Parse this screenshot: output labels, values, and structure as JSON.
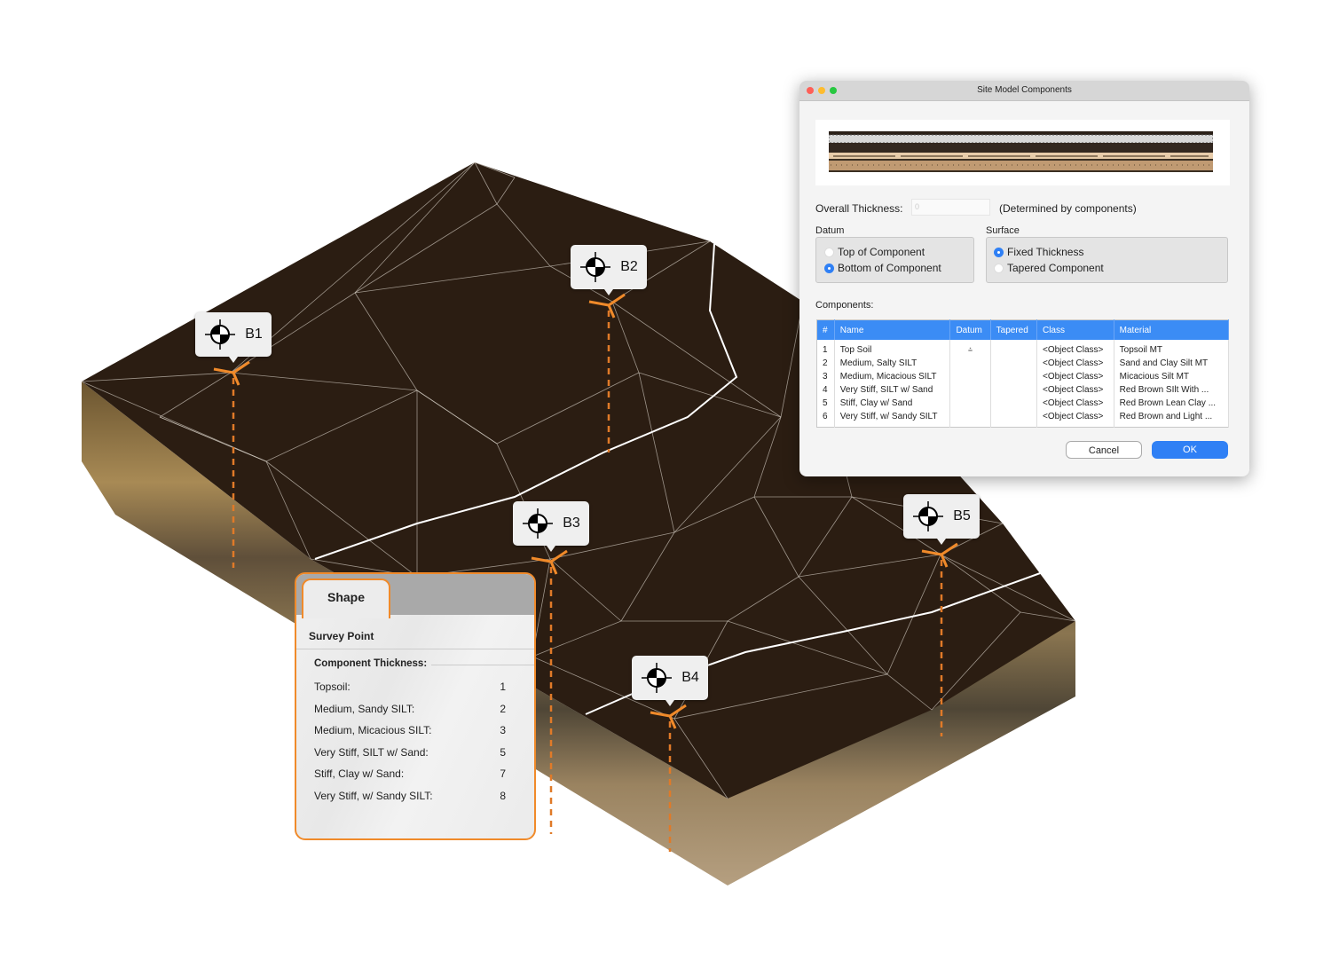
{
  "markers": [
    {
      "label": "B1"
    },
    {
      "label": "B2"
    },
    {
      "label": "B3"
    },
    {
      "label": "B4"
    },
    {
      "label": "B5"
    }
  ],
  "marker_icon": "survey-point-crosshair-icon",
  "colors": {
    "accent_orange": "#f08a2a",
    "terrain_top": "#2b1d12",
    "dialog_blue": "#3b8cf5"
  },
  "dialog": {
    "title": "Site Model Components",
    "overall_thickness_label": "Overall Thickness:",
    "overall_thickness_value": "0",
    "overall_thickness_note": "(Determined by components)",
    "datum": {
      "label": "Datum",
      "options": [
        {
          "label": "Top of Component",
          "selected": false
        },
        {
          "label": "Bottom of Component",
          "selected": true
        }
      ]
    },
    "surface": {
      "label": "Surface",
      "options": [
        {
          "label": "Fixed Thickness",
          "selected": true
        },
        {
          "label": "Tapered Component",
          "selected": false
        }
      ]
    },
    "components_label": "Components:",
    "columns": [
      "#",
      "Name",
      "Datum",
      "Tapered",
      "Class",
      "Material"
    ],
    "rows": [
      {
        "n": "1",
        "name": "Top Soil",
        "datum": "datum-icon",
        "cls": "<Object Class>",
        "material": "Topsoil MT"
      },
      {
        "n": "2",
        "name": "Medium, Salty SILT",
        "cls": "<Object Class>",
        "material": "Sand and Clay Silt MT"
      },
      {
        "n": "3",
        "name": "Medium, Micacious SILT",
        "cls": "<Object Class>",
        "material": "Micacious Silt MT"
      },
      {
        "n": "4",
        "name": "Very Stiff, SILT w/ Sand",
        "cls": "<Object Class>",
        "material": "Red Brown SIlt With ..."
      },
      {
        "n": "5",
        "name": "Stiff, Clay w/ Sand",
        "cls": "<Object Class>",
        "material": "Red Brown Lean Clay ..."
      },
      {
        "n": "6",
        "name": "Very Stiff, w/ Sandy SILT",
        "cls": "<Object Class>",
        "material": "Red Brown and Light ..."
      }
    ],
    "cancel": "Cancel",
    "ok": "OK"
  },
  "panel": {
    "tab": "Shape",
    "section": "Survey Point",
    "subheading": "Component Thickness:",
    "items": [
      {
        "label": "Topsoil:",
        "value": "1"
      },
      {
        "label": "Medium, Sandy SILT:",
        "value": "2"
      },
      {
        "label": "Medium, Micacious SILT:",
        "value": "3"
      },
      {
        "label": "Very Stiff, SILT w/ Sand:",
        "value": "5"
      },
      {
        "label": "Stiff, Clay w/ Sand:",
        "value": "7"
      },
      {
        "label": "Very Stiff, w/ Sandy SILT:",
        "value": "8"
      }
    ]
  }
}
